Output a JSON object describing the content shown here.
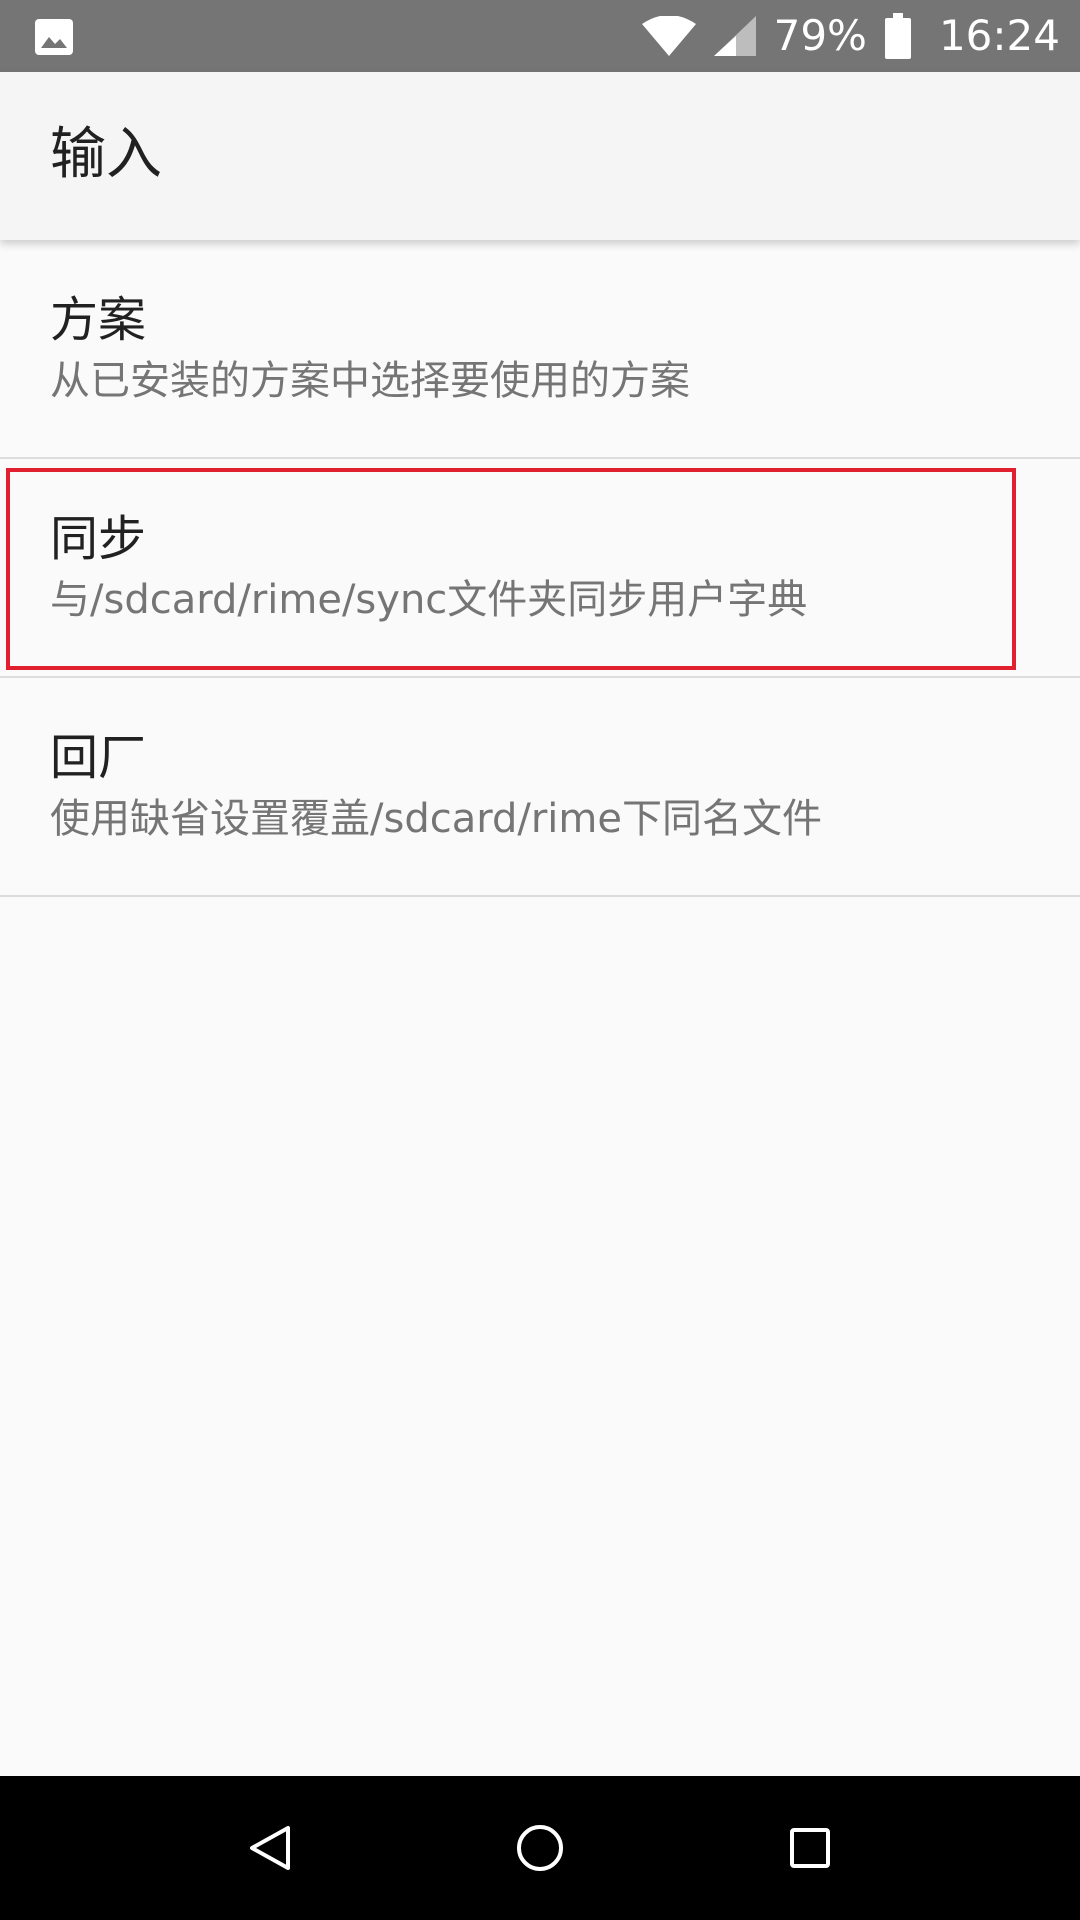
{
  "status_bar": {
    "left_icon": "image-icon",
    "battery_percent": "79%",
    "time": "16:24",
    "icons": [
      "wifi-icon",
      "signal-icon",
      "battery-icon"
    ]
  },
  "app_bar": {
    "title": "输入"
  },
  "preferences": [
    {
      "title": "方案",
      "summary": "从已安装的方案中选择要使用的方案"
    },
    {
      "title": "同步",
      "summary": "与/sdcard/rime/sync文件夹同步用户字典"
    },
    {
      "title": "回厂",
      "summary": "使用缺省设置覆盖/sdcard/rime下同名文件"
    }
  ],
  "highlight": {
    "color": "#e0202e",
    "target": "preferences.1"
  },
  "nav_bar": {
    "buttons": [
      "back-icon",
      "home-icon",
      "recents-icon"
    ]
  },
  "colors": {
    "status_bar": "#757575",
    "app_bar": "#f5f5f5",
    "background": "#fafafa",
    "title_text": "#212121",
    "summary_text": "#757575",
    "divider": "#dddddd",
    "nav_bar": "#000000"
  }
}
